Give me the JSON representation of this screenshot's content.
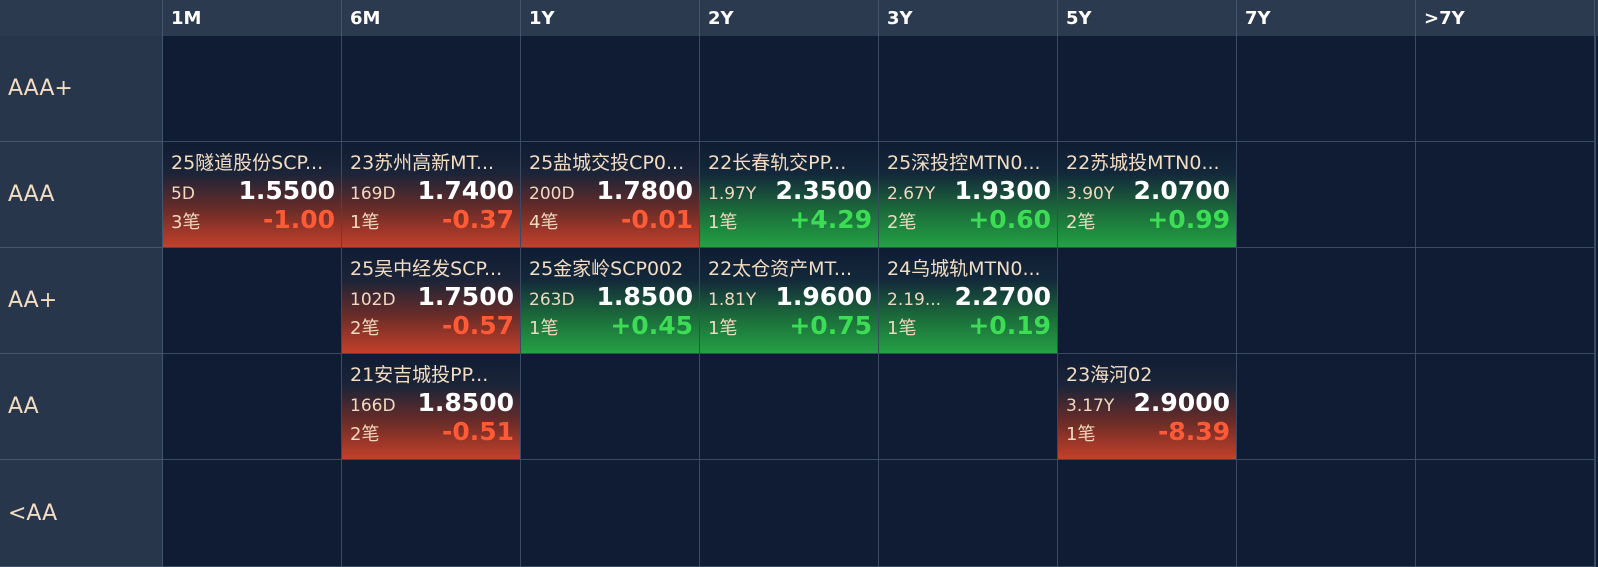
{
  "columns": [
    "1M",
    "6M",
    "1Y",
    "2Y",
    "3Y",
    "5Y",
    "7Y",
    ">7Y"
  ],
  "rows": [
    "AAA+",
    "AAA",
    "AA+",
    "AA",
    "<AA"
  ],
  "colors": {
    "up": "#3cdc55",
    "down": "#ff5a36",
    "header_bg": "#2c3a50",
    "grid_bg": "#0f1c33"
  },
  "cells": [
    {
      "row": 1,
      "col": 0,
      "name": "25隧道股份SCP...",
      "maturity": "5D",
      "yield": "1.5500",
      "count": "3笔",
      "change": "-1.00",
      "dir": "down"
    },
    {
      "row": 1,
      "col": 1,
      "name": "23苏州高新MT...",
      "maturity": "169D",
      "yield": "1.7400",
      "count": "1笔",
      "change": "-0.37",
      "dir": "down"
    },
    {
      "row": 1,
      "col": 2,
      "name": "25盐城交投CP0...",
      "maturity": "200D",
      "yield": "1.7800",
      "count": "4笔",
      "change": "-0.01",
      "dir": "down"
    },
    {
      "row": 1,
      "col": 3,
      "name": "22长春轨交PP...",
      "maturity": "1.97Y",
      "yield": "2.3500",
      "count": "1笔",
      "change": "+4.29",
      "dir": "up"
    },
    {
      "row": 1,
      "col": 4,
      "name": "25深投控MTN0...",
      "maturity": "2.67Y",
      "yield": "1.9300",
      "count": "2笔",
      "change": "+0.60",
      "dir": "up"
    },
    {
      "row": 1,
      "col": 5,
      "name": "22苏城投MTN0...",
      "maturity": "3.90Y",
      "yield": "2.0700",
      "count": "2笔",
      "change": "+0.99",
      "dir": "up"
    },
    {
      "row": 2,
      "col": 1,
      "name": "25吴中经发SCP...",
      "maturity": "102D",
      "yield": "1.7500",
      "count": "2笔",
      "change": "-0.57",
      "dir": "down"
    },
    {
      "row": 2,
      "col": 2,
      "name": "25金家岭SCP002",
      "maturity": "263D",
      "yield": "1.8500",
      "count": "1笔",
      "change": "+0.45",
      "dir": "up"
    },
    {
      "row": 2,
      "col": 3,
      "name": "22太仓资产MT...",
      "maturity": "1.81Y",
      "yield": "1.9600",
      "count": "1笔",
      "change": "+0.75",
      "dir": "up"
    },
    {
      "row": 2,
      "col": 4,
      "name": "24乌城轨MTN0...",
      "maturity": "2.19...",
      "yield": "2.2700",
      "count": "1笔",
      "change": "+0.19",
      "dir": "up"
    },
    {
      "row": 3,
      "col": 1,
      "name": "21安吉城投PP...",
      "maturity": "166D",
      "yield": "1.8500",
      "count": "2笔",
      "change": "-0.51",
      "dir": "down"
    },
    {
      "row": 3,
      "col": 5,
      "name": "23海河02",
      "maturity": "3.17Y",
      "yield": "2.9000",
      "count": "1笔",
      "change": "-8.39",
      "dir": "down"
    }
  ]
}
